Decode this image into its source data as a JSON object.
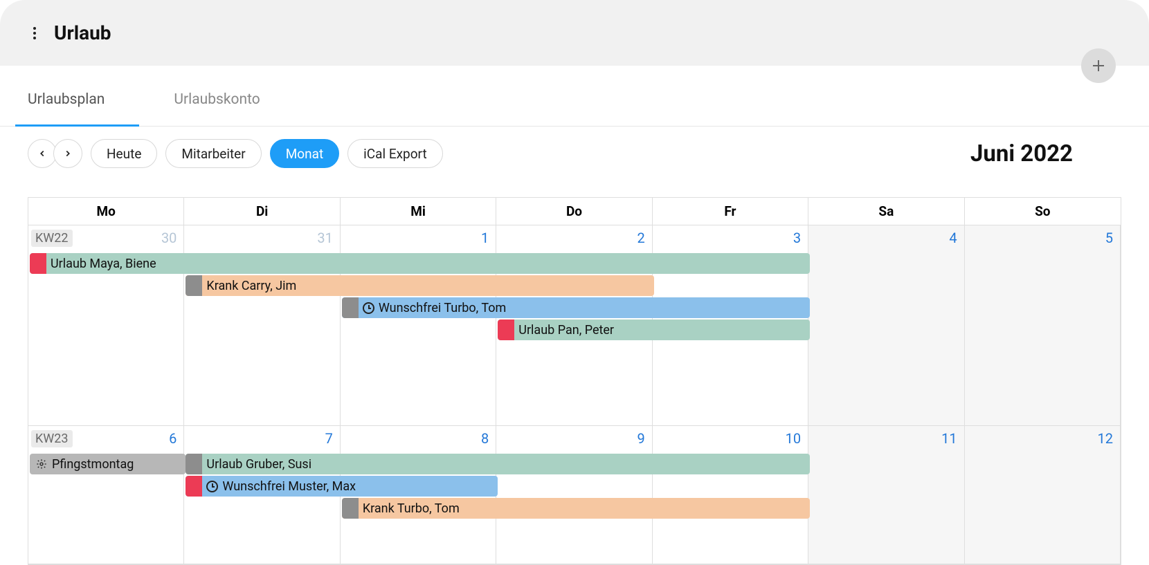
{
  "header": {
    "title": "Urlaub"
  },
  "tabs": [
    {
      "label": "Urlaubsplan",
      "active": true
    },
    {
      "label": "Urlaubskonto",
      "active": false
    }
  ],
  "toolbar": {
    "today": "Heute",
    "employees": "Mitarbeiter",
    "month": "Monat",
    "ical": "iCal Export",
    "current_month": "Juni 2022"
  },
  "weekdays": [
    "Mo",
    "Di",
    "Mi",
    "Do",
    "Fr",
    "Sa",
    "So"
  ],
  "weeks": [
    {
      "label": "KW22",
      "days": [
        {
          "num": "30",
          "muted": true,
          "weekend": false
        },
        {
          "num": "31",
          "muted": true,
          "weekend": false
        },
        {
          "num": "1",
          "muted": false,
          "weekend": false
        },
        {
          "num": "2",
          "muted": false,
          "weekend": false
        },
        {
          "num": "3",
          "muted": false,
          "weekend": false
        },
        {
          "num": "4",
          "muted": false,
          "weekend": true
        },
        {
          "num": "5",
          "muted": false,
          "weekend": true
        }
      ],
      "events": [
        {
          "row": 0,
          "start": 0,
          "span": 5,
          "bg": "teal",
          "stripe": "red",
          "icon": null,
          "label": "Urlaub Maya, Biene"
        },
        {
          "row": 1,
          "start": 1,
          "span": 3,
          "bg": "peach",
          "stripe": "gray",
          "icon": null,
          "label": "Krank Carry, Jim"
        },
        {
          "row": 2,
          "start": 2,
          "span": 3,
          "bg": "blue",
          "stripe": "gray",
          "icon": "clock",
          "label": "Wunschfrei Turbo, Tom"
        },
        {
          "row": 3,
          "start": 3,
          "span": 2,
          "bg": "teal",
          "stripe": "red",
          "icon": null,
          "label": "Urlaub Pan, Peter"
        }
      ]
    },
    {
      "label": "KW23",
      "days": [
        {
          "num": "6",
          "muted": false,
          "weekend": false
        },
        {
          "num": "7",
          "muted": false,
          "weekend": false
        },
        {
          "num": "8",
          "muted": false,
          "weekend": false
        },
        {
          "num": "9",
          "muted": false,
          "weekend": false
        },
        {
          "num": "10",
          "muted": false,
          "weekend": false
        },
        {
          "num": "11",
          "muted": false,
          "weekend": true
        },
        {
          "num": "12",
          "muted": false,
          "weekend": true
        }
      ],
      "events": [
        {
          "row": 0,
          "start": 0,
          "span": 1,
          "bg": "gray",
          "stripe": null,
          "icon": "gear",
          "label": "Pfingstmontag"
        },
        {
          "row": 0,
          "start": 1,
          "span": 4,
          "bg": "teal",
          "stripe": "gray",
          "icon": null,
          "label": "Urlaub Gruber, Susi"
        },
        {
          "row": 1,
          "start": 1,
          "span": 2,
          "bg": "blue",
          "stripe": "red",
          "icon": "clock",
          "label": "Wunschfrei Muster, Max"
        },
        {
          "row": 2,
          "start": 2,
          "span": 3,
          "bg": "peach",
          "stripe": "gray",
          "icon": null,
          "label": "Krank Turbo, Tom"
        }
      ]
    }
  ],
  "colors": {
    "teal": "#a9d1c3",
    "peach": "#f6c7a1",
    "blue": "#8bc0eb",
    "gray": "#b7b7b7",
    "stripe_red": "#ec3b55",
    "stripe_gray": "#8d8d8d",
    "accent": "#1e9df7"
  }
}
